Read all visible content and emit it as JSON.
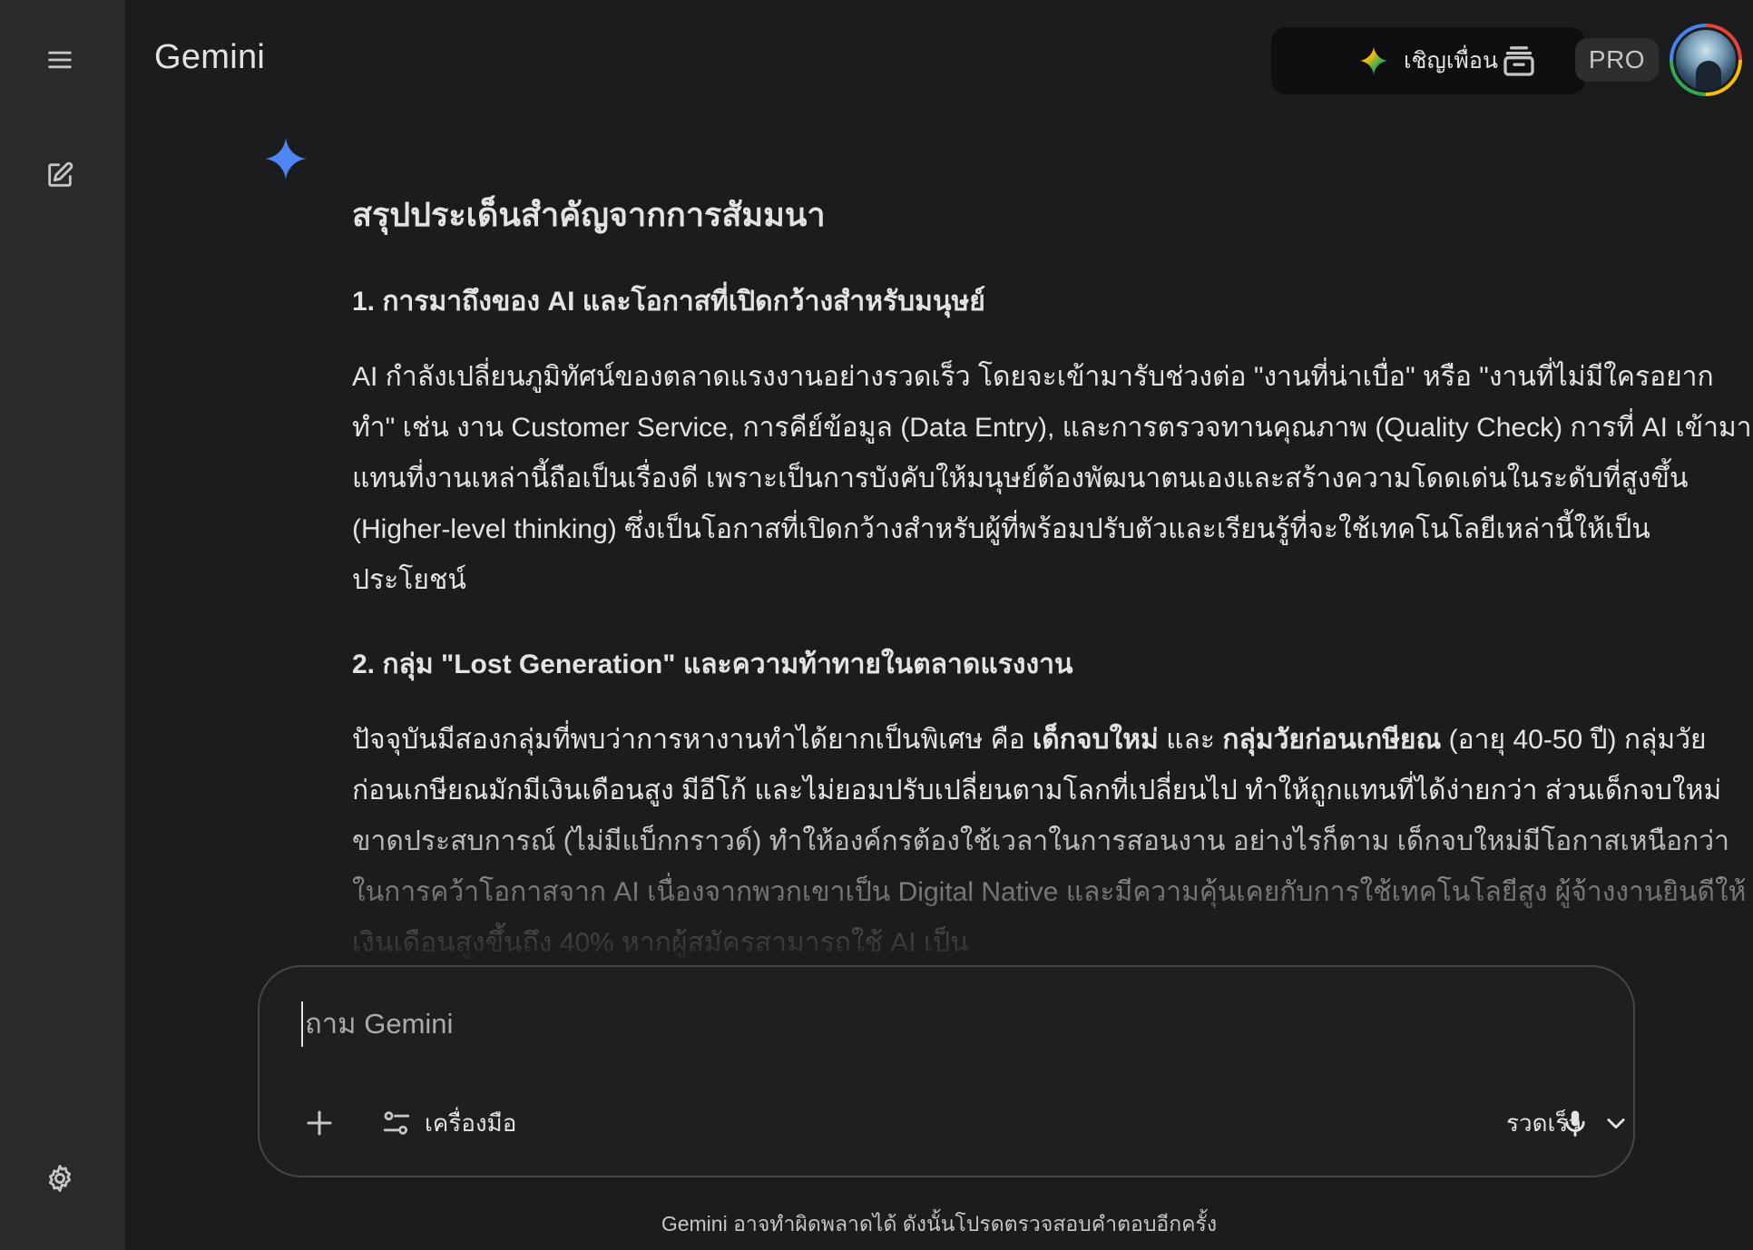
{
  "app": {
    "title": "Gemini"
  },
  "sidebar": {
    "menu_icon": "menu-icon",
    "new_chat_icon": "edit-icon",
    "settings_icon": "gear-icon"
  },
  "header": {
    "invite_label": "เชิญเพื่อน",
    "pro_label": "PRO"
  },
  "response": {
    "title": "สรุปประเด็นสำคัญจากการสัมมนา",
    "sections": [
      {
        "heading": "1. การมาถึงของ AI และโอกาสที่เปิดกว้างสำหรับมนุษย์",
        "body": "AI กำลังเปลี่ยนภูมิทัศน์ของตลาดแรงงานอย่างรวดเร็ว โดยจะเข้ามารับช่วงต่อ \"งานที่น่าเบื่อ\" หรือ \"งานที่ไม่มีใครอยากทำ\" เช่น งาน Customer Service, การคีย์ข้อมูล (Data Entry), และการตรวจทานคุณภาพ (Quality Check) การที่ AI เข้ามาแทนที่งานเหล่านี้ถือเป็นเรื่องดี เพราะเป็นการบังคับให้มนุษย์ต้องพัฒนาตนเองและสร้างความโดดเด่นในระดับที่สูงขึ้น (Higher-level thinking) ซึ่งเป็นโอกาสที่เปิดกว้างสำหรับผู้ที่พร้อมปรับตัวและเรียนรู้ที่จะใช้เทคโนโลยีเหล่านี้ให้เป็นประโยชน์"
      },
      {
        "heading": "2. กลุ่ม \"Lost Generation\" และความท้าทายในตลาดแรงงาน",
        "body_parts": {
          "p1": "ปัจจุบันมีสองกลุ่มที่พบว่าการหางานทำได้ยากเป็นพิเศษ คือ ",
          "b1": "เด็กจบใหม่",
          "p2": " และ ",
          "b2": "กลุ่มวัยก่อนเกษียณ",
          "p3": " (อายุ 40-50 ปี) กลุ่มวัยก่อนเกษียณมักมีเงินเดือนสูง มีอีโก้ และไม่ยอมปรับเปลี่ยนตามโลกที่เปลี่ยนไป ทำให้ถูกแทนที่ได้ง่ายกว่า ส่วนเด็กจบใหม่ขาดประสบการณ์ (ไม่มีแบ็กกราวด์) ทำให้องค์กรต้องใช้เวลาในการสอนงาน อย่างไรก็ตาม เด็กจบใหม่มีโอกาสเหนือกว่าในการคว้าโอกาสจาก AI เนื่องจากพวกเขาเป็น Digital Native และมีความคุ้นเคยกับการใช้เทคโนโลยีสูง ผู้จ้างงานยินดีให้เงินเดือนสูงขึ้นถึง 40% หากผู้สมัครสามารถใช้ AI เป็น"
        }
      }
    ]
  },
  "composer": {
    "placeholder": "ถาม Gemini",
    "value": "",
    "tools_label": "เครื่องมือ",
    "model_label": "รวดเร็ว"
  },
  "footer": {
    "disclaimer": "Gemini อาจทำผิดพลาดได้ ดังนั้นโปรดตรวจสอบคำตอบอีกครั้ง"
  },
  "colors": {
    "background": "#1b1c1d",
    "sidebar": "#282a2c",
    "text": "#e3e3e3",
    "accent_spark": "#4e86f5"
  }
}
